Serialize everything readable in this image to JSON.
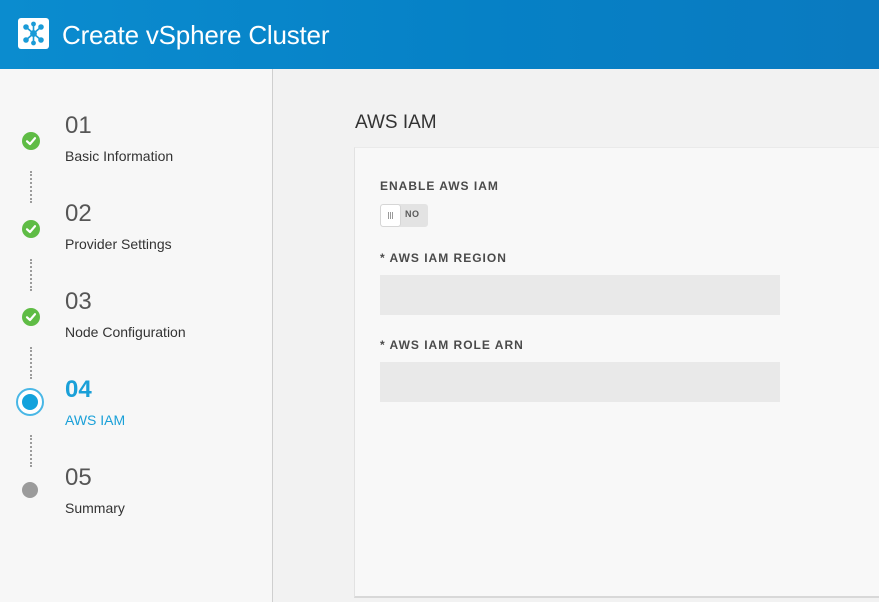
{
  "header": {
    "title": "Create vSphere Cluster",
    "logo_icon": "cluster-network-icon",
    "background_color": "#0a86c9"
  },
  "wizard": {
    "steps": [
      {
        "number": "01",
        "label": "Basic Information",
        "status": "complete",
        "icon": "check-circle-icon"
      },
      {
        "number": "02",
        "label": "Provider Settings",
        "status": "complete",
        "icon": "check-circle-icon"
      },
      {
        "number": "03",
        "label": "Node Configuration",
        "status": "complete",
        "icon": "check-circle-icon"
      },
      {
        "number": "04",
        "label": "AWS IAM",
        "status": "active",
        "icon": "active-step-radio-icon"
      },
      {
        "number": "05",
        "label": "Summary",
        "status": "pending",
        "icon": "pending-step-dot-icon"
      }
    ],
    "colors": {
      "complete": "#5fbc45",
      "active": "#12a2dc",
      "pending": "#9b9b9b"
    }
  },
  "main": {
    "section_title": "AWS IAM",
    "enable": {
      "label": "ENABLE AWS IAM",
      "toggle_text": "NO",
      "enabled": false
    },
    "region": {
      "label": "* AWS IAM REGION",
      "value": "",
      "placeholder": ""
    },
    "role_arn": {
      "label": "* AWS IAM ROLE ARN",
      "value": "",
      "placeholder": ""
    }
  }
}
